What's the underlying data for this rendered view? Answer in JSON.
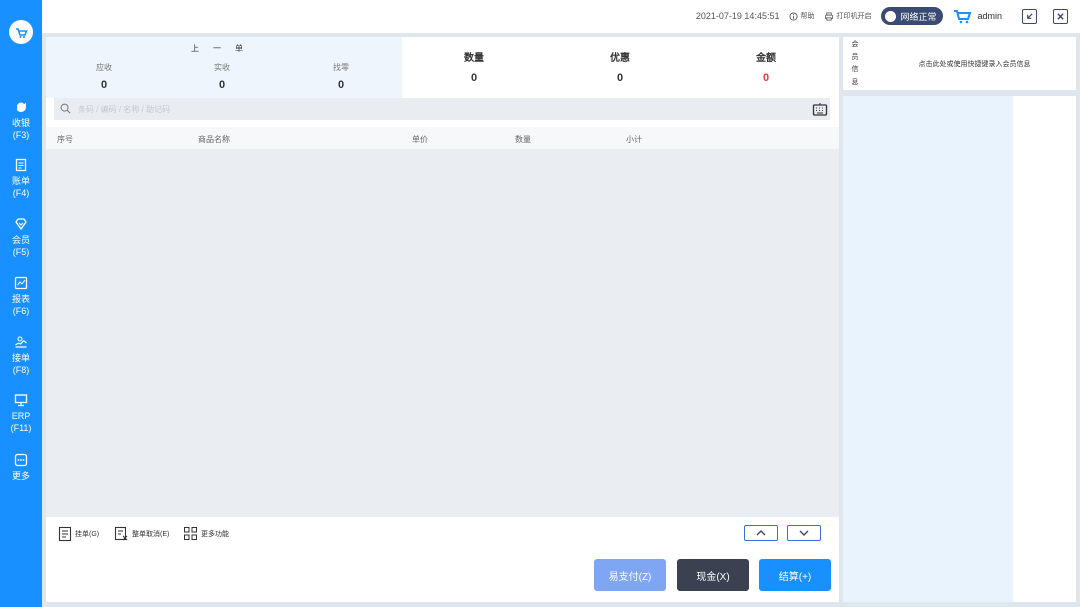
{
  "sidebar": {
    "items": [
      {
        "label": "收银",
        "key": "(F3)",
        "icon": "cashier-icon"
      },
      {
        "label": "账单",
        "key": "(F4)",
        "icon": "bill-icon"
      },
      {
        "label": "会员",
        "key": "(F5)",
        "icon": "member-icon"
      },
      {
        "label": "报表",
        "key": "(F6)",
        "icon": "report-icon"
      },
      {
        "label": "接单",
        "key": "(F8)",
        "icon": "order-icon"
      },
      {
        "label": "ERP",
        "key": "(F11)",
        "icon": "erp-icon"
      },
      {
        "label": "更多",
        "key": "",
        "icon": "more-icon"
      }
    ]
  },
  "topbar": {
    "datetime": "2021-07-19 14:45:51",
    "help": "帮助",
    "printer": "打印机开启",
    "network": "网络正常",
    "user": "admin"
  },
  "last_order": {
    "title": "上一单",
    "receivable_label": "应收",
    "receivable": "0",
    "received_label": "实收",
    "received": "0",
    "change_label": "找零",
    "change": "0"
  },
  "summary": {
    "qty_label": "数量",
    "qty": "0",
    "discount_label": "优惠",
    "discount": "0",
    "amount_label": "金额",
    "amount": "0",
    "amount_color": "#e53935"
  },
  "search": {
    "placeholder": "条码 / 编码 / 名称 / 助记码"
  },
  "table": {
    "columns": [
      "序号",
      "商品名称",
      "单价",
      "数量",
      "小计"
    ]
  },
  "toolbar": {
    "hang": "挂单(G)",
    "cancel": "整单取消(E)",
    "more": "更多功能"
  },
  "payment": {
    "easy_pay": "易支付(Z)",
    "cash": "现金(X)",
    "checkout": "结算(+)"
  },
  "member": {
    "vertical_label": [
      "会",
      "员",
      "信",
      "息"
    ],
    "hint": "点击此处或使用快捷键录入会员信息"
  },
  "colors": {
    "accent": "#1890ff",
    "dark": "#3b4a72"
  }
}
